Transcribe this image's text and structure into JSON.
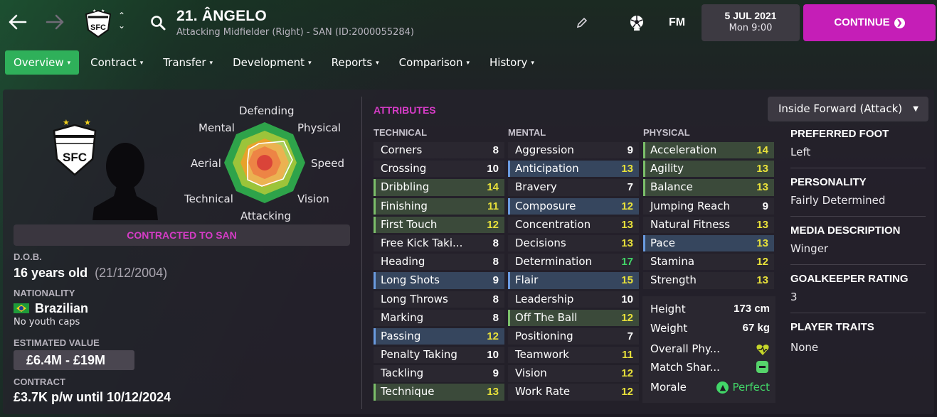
{
  "header": {
    "back_icon": "arrow-left-icon",
    "forward_icon": "arrow-right-icon",
    "player_title": "21. ÂNGELO",
    "player_subtitle": "Attacking Midfielder (Right) - SAN (ID:2000055284)",
    "game_logo": "FM",
    "date": "5 JUL 2021",
    "time": "Mon 9:00",
    "continue_label": "CONTINUE"
  },
  "tabs": [
    {
      "label": "Overview"
    },
    {
      "label": "Contract"
    },
    {
      "label": "Transfer"
    },
    {
      "label": "Development"
    },
    {
      "label": "Reports"
    },
    {
      "label": "Comparison"
    },
    {
      "label": "History"
    }
  ],
  "polar": {
    "labels": {
      "defending": "Defending",
      "physical": "Physical",
      "speed": "Speed",
      "vision": "Vision",
      "attacking": "Attacking",
      "technical": "Technical",
      "aerial": "Aerial",
      "mental": "Mental"
    }
  },
  "profile": {
    "contract_banner": "CONTRACTED TO SAN",
    "dob_label": "D.O.B.",
    "age": "16 years old",
    "dob": "(21/12/2004)",
    "nationality_label": "NATIONALITY",
    "nationality": "Brazilian",
    "youth_caps": "No youth caps",
    "value_label": "ESTIMATED VALUE",
    "value": "£6.4M - £19M",
    "contract_label": "CONTRACT",
    "contract": "£3.7K p/w until 10/12/2024"
  },
  "attributes": {
    "title": "ATTRIBUTES",
    "technical_label": "TECHNICAL",
    "mental_label": "MENTAL",
    "physical_label": "PHYSICAL",
    "technical": [
      {
        "name": "Corners",
        "value": "8"
      },
      {
        "name": "Crossing",
        "value": "10"
      },
      {
        "name": "Dribbling",
        "value": "14"
      },
      {
        "name": "Finishing",
        "value": "11"
      },
      {
        "name": "First Touch",
        "value": "12"
      },
      {
        "name": "Free Kick Taki...",
        "value": "8"
      },
      {
        "name": "Heading",
        "value": "8"
      },
      {
        "name": "Long Shots",
        "value": "9"
      },
      {
        "name": "Long Throws",
        "value": "8"
      },
      {
        "name": "Marking",
        "value": "8"
      },
      {
        "name": "Passing",
        "value": "12"
      },
      {
        "name": "Penalty Taking",
        "value": "10"
      },
      {
        "name": "Tackling",
        "value": "9"
      },
      {
        "name": "Technique",
        "value": "13"
      }
    ],
    "mental": [
      {
        "name": "Aggression",
        "value": "9"
      },
      {
        "name": "Anticipation",
        "value": "13"
      },
      {
        "name": "Bravery",
        "value": "7"
      },
      {
        "name": "Composure",
        "value": "12"
      },
      {
        "name": "Concentration",
        "value": "13"
      },
      {
        "name": "Decisions",
        "value": "13"
      },
      {
        "name": "Determination",
        "value": "17"
      },
      {
        "name": "Flair",
        "value": "15"
      },
      {
        "name": "Leadership",
        "value": "10"
      },
      {
        "name": "Off The Ball",
        "value": "12"
      },
      {
        "name": "Positioning",
        "value": "7"
      },
      {
        "name": "Teamwork",
        "value": "11"
      },
      {
        "name": "Vision",
        "value": "12"
      },
      {
        "name": "Work Rate",
        "value": "12"
      }
    ],
    "physical": [
      {
        "name": "Acceleration",
        "value": "14"
      },
      {
        "name": "Agility",
        "value": "13"
      },
      {
        "name": "Balance",
        "value": "13"
      },
      {
        "name": "Jumping Reach",
        "value": "9"
      },
      {
        "name": "Natural Fitness",
        "value": "13"
      },
      {
        "name": "Pace",
        "value": "13"
      },
      {
        "name": "Stamina",
        "value": "12"
      },
      {
        "name": "Strength",
        "value": "13"
      }
    ],
    "extra": {
      "height_label": "Height",
      "height": "173 cm",
      "weight_label": "Weight",
      "weight": "67 kg",
      "condition_label": "Overall Phy...",
      "sharpness_label": "Match Shar...",
      "morale_label": "Morale",
      "morale": "Perfect"
    }
  },
  "side_info": {
    "role": "Inside Forward (Attack)",
    "preferred_foot_label": "PREFERRED FOOT",
    "preferred_foot": "Left",
    "personality_label": "PERSONALITY",
    "personality": "Fairly Determined",
    "media_label": "MEDIA DESCRIPTION",
    "media": "Winger",
    "gk_label": "GOALKEEPER RATING",
    "gk": "3",
    "traits_label": "PLAYER TRAITS",
    "traits": "None"
  },
  "colors": {
    "accent_magenta": "#c51eb7",
    "tab_active": "#2fb05a",
    "value_yellow": "#e8e13a",
    "value_green": "#42d668"
  }
}
